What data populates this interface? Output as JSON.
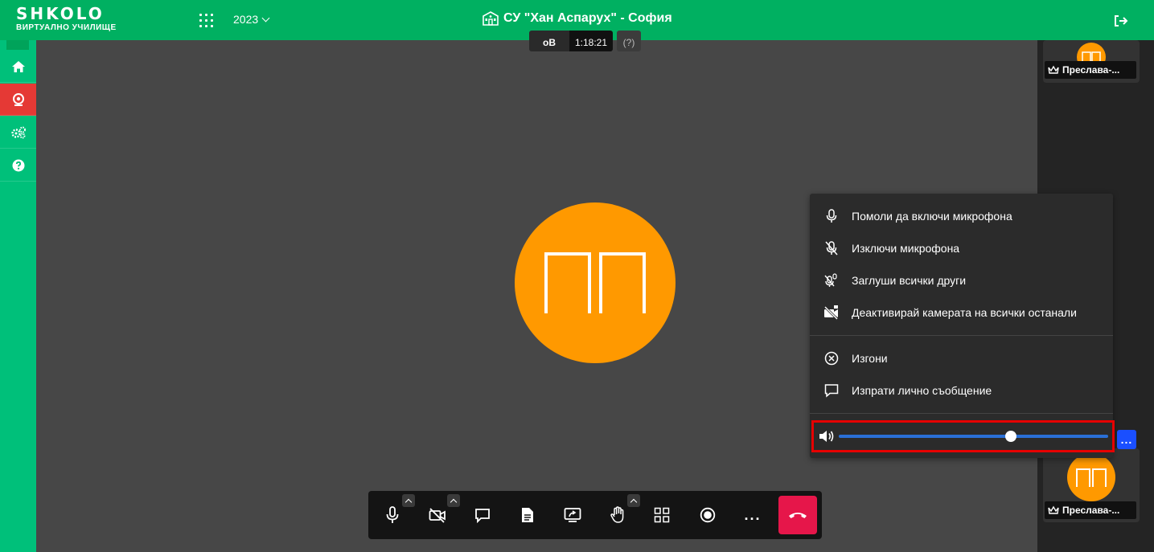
{
  "header": {
    "logo_main": "SHKOLO",
    "logo_sub": "ВИРТУАЛНО УЧИЛИЩЕ",
    "year": "2023",
    "school_title": "СУ \"Хан Аспарух\" - София"
  },
  "stage": {
    "timer_left": "oB",
    "timer_right": "1:18:21",
    "timer_extra": "(?)",
    "avatar_initials": "ПП"
  },
  "participants": [
    {
      "name": "Преслава-...",
      "initials": "ПП"
    },
    {
      "name": "Преслава-...",
      "initials": "ПП"
    }
  ],
  "more_button": "...",
  "context_menu": {
    "items_top": [
      {
        "label": "Помоли да включи микрофона",
        "icon": "mic-icon"
      },
      {
        "label": "Изключи микрофона",
        "icon": "mic-off-icon"
      },
      {
        "label": "Заглуши всички други",
        "icon": "mute-all-icon"
      },
      {
        "label": "Деактивирай камерата на всички останали",
        "icon": "camera-off-icon"
      }
    ],
    "items_bottom": [
      {
        "label": "Изгони",
        "icon": "kick-icon"
      },
      {
        "label": "Изпрати лично съобщение",
        "icon": "message-icon"
      }
    ],
    "volume_level": 0.64
  },
  "toolbar": {
    "more_label": "..."
  },
  "colors": {
    "brand_green": "#00b061",
    "sidebar_green": "#00c07a",
    "avatar_orange": "#ff9900",
    "hangup_red": "#e6164a",
    "highlight_red": "#e60000",
    "accent_blue": "#1a4fff"
  }
}
